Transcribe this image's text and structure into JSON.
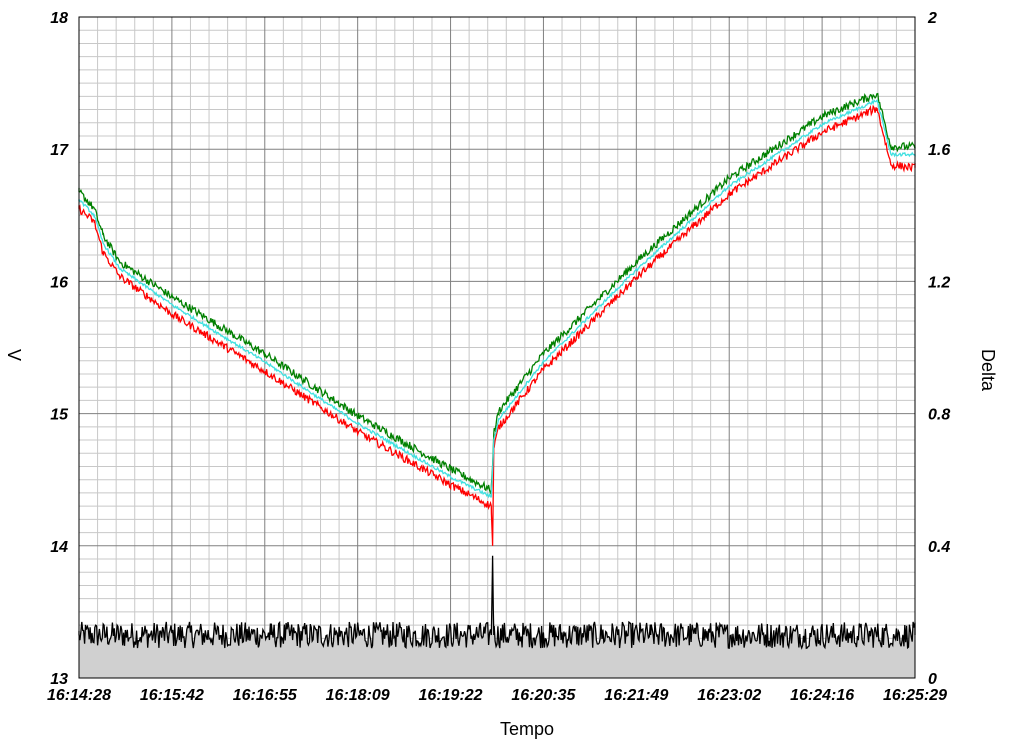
{
  "chart_data": {
    "type": "line",
    "xlabel": "Tempo",
    "ylabel": "V",
    "y2label": "Delta",
    "x_ticks": [
      "16:14:28",
      "16:15:42",
      "16:16:55",
      "16:18:09",
      "16:19:22",
      "16:20:35",
      "16:21:49",
      "16:23:02",
      "16:24:16",
      "16:25:29"
    ],
    "x_range": [
      "16:14:28",
      "16:25:29"
    ],
    "ylim": [
      13,
      18
    ],
    "y_ticks": [
      "13",
      "14",
      "15",
      "16",
      "17",
      "18"
    ],
    "y2lim": [
      0,
      2
    ],
    "y2_ticks": [
      "0",
      "0.4",
      "0.8",
      "1.2",
      "1.6",
      "2"
    ],
    "grid": true,
    "legend": "none",
    "series": [
      {
        "axis": "left",
        "color": "#008000",
        "x": [
          "16:14:28",
          "16:14:40",
          "16:14:47",
          "16:15:00",
          "16:15:42",
          "16:16:55",
          "16:18:09",
          "16:19:22",
          "16:19:54",
          "16:19:56",
          "16:20:00",
          "16:20:35",
          "16:21:49",
          "16:23:02",
          "16:24:16",
          "16:24:59",
          "16:25:10",
          "16:25:29"
        ],
        "values": [
          16.68,
          16.55,
          16.35,
          16.15,
          15.88,
          15.45,
          14.98,
          14.58,
          14.42,
          14.85,
          15.02,
          15.45,
          16.15,
          16.78,
          17.25,
          17.42,
          17.02,
          17.02
        ]
      },
      {
        "axis": "left",
        "color": "#40e0e0",
        "x": [
          "16:14:28",
          "16:14:40",
          "16:14:47",
          "16:15:00",
          "16:15:42",
          "16:16:55",
          "16:18:09",
          "16:19:22",
          "16:19:54",
          "16:19:56",
          "16:20:00",
          "16:20:35",
          "16:21:49",
          "16:23:02",
          "16:24:16",
          "16:24:59",
          "16:25:10",
          "16:25:29"
        ],
        "values": [
          16.62,
          16.5,
          16.29,
          16.1,
          15.82,
          15.39,
          14.92,
          14.52,
          14.37,
          14.8,
          14.96,
          15.39,
          16.09,
          16.72,
          17.19,
          17.37,
          16.96,
          16.96
        ]
      },
      {
        "axis": "left",
        "color": "#ff0000",
        "x": [
          "16:14:28",
          "16:14:40",
          "16:14:47",
          "16:15:00",
          "16:15:42",
          "16:16:55",
          "16:18:09",
          "16:19:22",
          "16:19:54",
          "16:19:55",
          "16:19:56",
          "16:20:00",
          "16:20:35",
          "16:21:49",
          "16:23:02",
          "16:24:16",
          "16:24:59",
          "16:25:10",
          "16:25:29"
        ],
        "values": [
          16.55,
          16.45,
          16.22,
          16.04,
          15.75,
          15.32,
          14.86,
          14.46,
          14.3,
          14.0,
          14.74,
          14.9,
          15.33,
          16.03,
          16.66,
          17.13,
          17.31,
          16.88,
          16.86
        ]
      },
      {
        "axis": "right",
        "color": "#000000",
        "fill": "#d0d0d0",
        "x": [
          "16:14:28",
          "16:17:00",
          "16:19:54",
          "16:19:55",
          "16:19:56",
          "16:22:00",
          "16:25:29"
        ],
        "values": [
          0.13,
          0.13,
          0.13,
          0.37,
          0.13,
          0.13,
          0.13
        ]
      }
    ]
  }
}
